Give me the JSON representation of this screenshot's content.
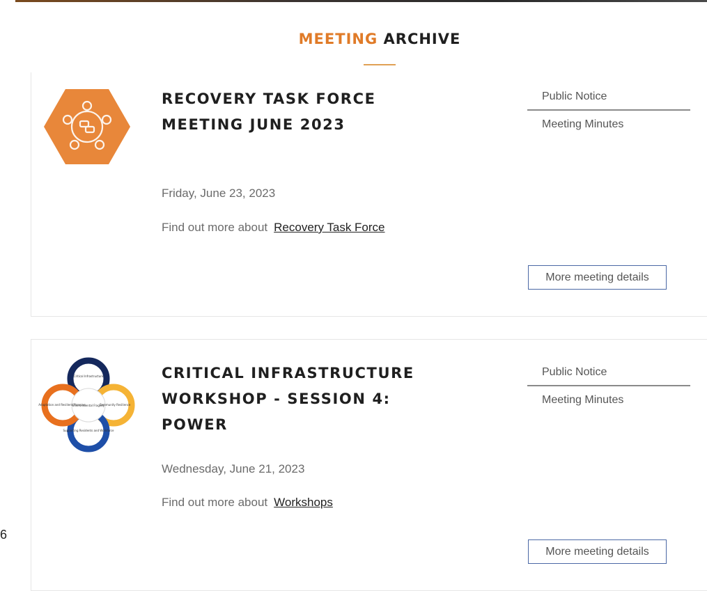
{
  "section": {
    "title_accent": "MEETING",
    "title_rest": "ARCHIVE"
  },
  "stray_digit": "6",
  "meetings": [
    {
      "title_lines": [
        "RECOVERY TASK FORCE",
        "MEETING JUNE 2023"
      ],
      "date": "Friday, June 23, 2023",
      "more_prefix": "Find out more about",
      "more_link": "Recovery Task Force",
      "links": [
        "Public Notice",
        "Meeting Minutes"
      ],
      "button": "More meeting details",
      "icon": "meeting-people-hexagon-icon",
      "icon_color": "#e8873a"
    },
    {
      "title_lines": [
        "CRITICAL INFRASTRUCTURE",
        "WORKSHOP - SESSION 4:",
        "POWER"
      ],
      "date": "Wednesday, June 21, 2023",
      "more_prefix": "Find out more about",
      "more_link": "Workshops",
      "links": [
        "Public Notice",
        "Meeting Minutes"
      ],
      "button": "More meeting details",
      "icon": "resilience-circles-diagram-icon",
      "diagram_labels": [
        "Critical Infrastructure",
        "Community Resilience",
        "Supporting Residents and Workforce",
        "Adaptation and Resilient Planning",
        "Environmental Fragility"
      ],
      "colors": {
        "navy": "#14285c",
        "orange": "#e8701e",
        "gold": "#f5b335",
        "blue": "#1e4fa8"
      }
    }
  ]
}
